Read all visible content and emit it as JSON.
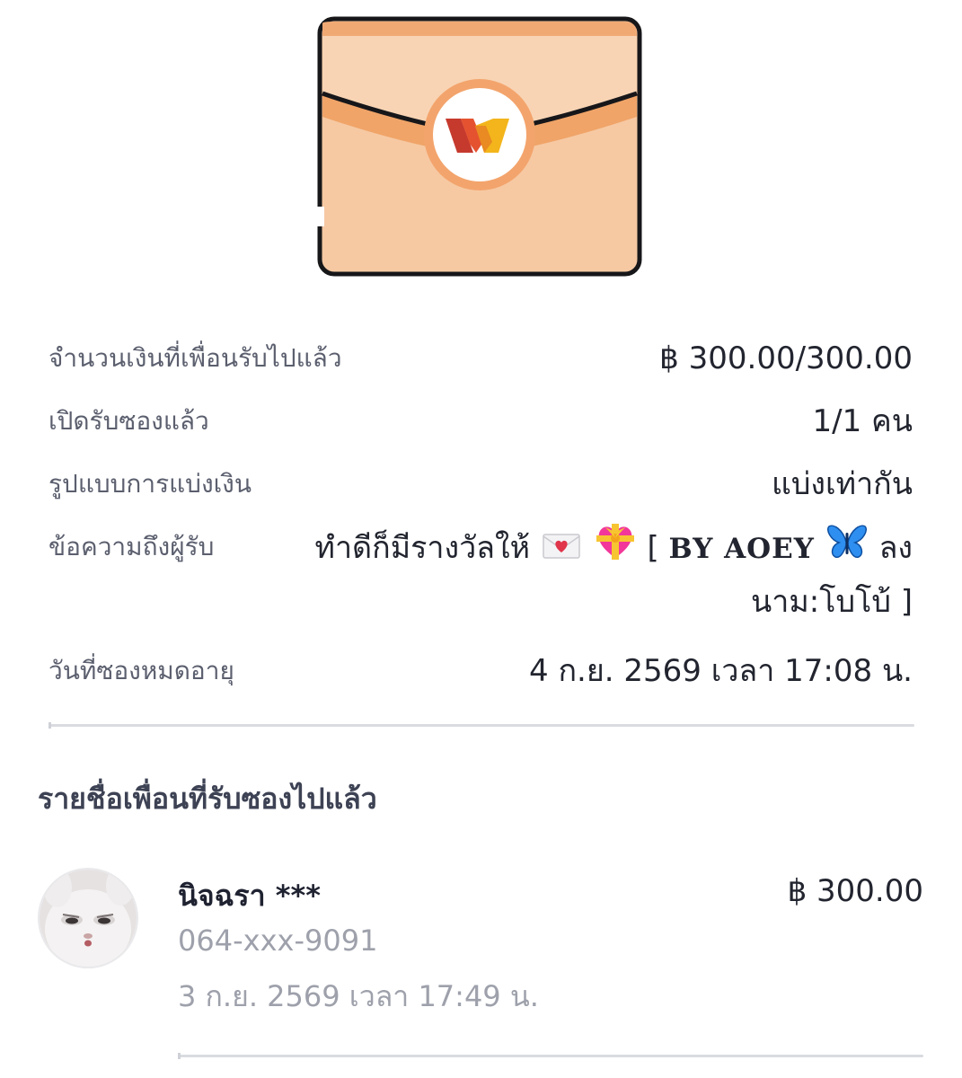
{
  "envelope": {
    "logo": "wallet-logo-icon",
    "colors": {
      "body": "#f6c9a3",
      "flap": "#f1a974",
      "band": "#ee9a5c",
      "outline": "#17171a"
    }
  },
  "details": {
    "amount_received": {
      "label": "จำนวนเงินที่เพื่อนรับไปแล้ว",
      "value": "฿ 300.00/300.00"
    },
    "opened": {
      "label": "เปิดรับซองแล้ว",
      "value": "1/1 คน"
    },
    "split_type": {
      "label": "รูปแบบการแบ่งเงิน",
      "value": "แบ่งเท่ากัน"
    },
    "message": {
      "label": "ข้อความถึงผู้รับ",
      "text_before": "ทำดีก็มีรางวัลให้",
      "bracket_open": "[",
      "by": "BY AOEY",
      "text_after": "ลงนาม:โบโบ้ ]",
      "emojis": [
        "love-letter-icon",
        "heart-with-ribbon-icon",
        "butterfly-icon"
      ]
    },
    "expiry": {
      "label": "วันที่ซองหมดอายุ",
      "value": "4 ก.ย. 2569 เวลา 17:08 น."
    }
  },
  "recipients_section": {
    "title": "รายชื่อเพื่อนที่รับซองไปแล้ว",
    "items": [
      {
        "name": "นิจฉรา ***",
        "phone": "064-xxx-9091",
        "date": "3 ก.ย. 2569 เวลา 17:49 น.",
        "amount": "฿ 300.00",
        "avatar": "white-rabbit-avatar"
      }
    ]
  }
}
